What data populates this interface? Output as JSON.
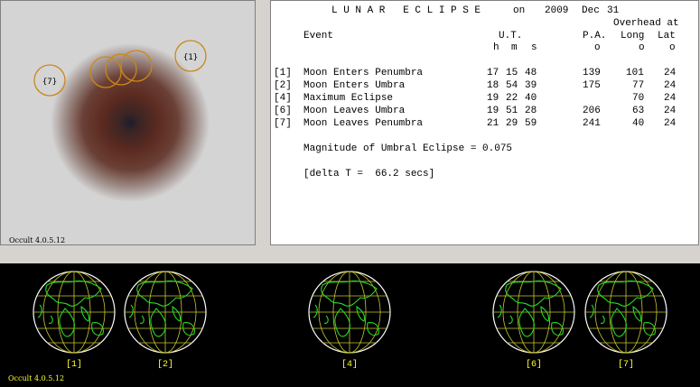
{
  "diagram": {
    "contact_labels": [
      "{1}",
      "{7}"
    ],
    "software": "Occult 4.0.5.12",
    "colors": {
      "penumbra_edge": "#d4d4d4",
      "umbra": "#5b2a20",
      "center": "#1c1e2a",
      "moon_outline": "#c9871a"
    }
  },
  "report": {
    "title": "L U N A R   E C L I P S E",
    "on_label": "on",
    "year": "2009",
    "month": "Dec",
    "day": "31",
    "overhead_header": "Overhead at",
    "event_header": "Event",
    "ut_header": "U.T.",
    "pa_header": "P.A.",
    "long_header": "Long",
    "lat_header": "Lat",
    "h_unit": "h",
    "m_unit": "m",
    "s_unit": "s",
    "degree_mark": "o",
    "events": [
      {
        "num": "[1]",
        "name": "Moon Enters Penumbra",
        "h": "17",
        "m": "15",
        "s": "48",
        "pa": "139",
        "long": "101",
        "lat": "24"
      },
      {
        "num": "[2]",
        "name": "Moon Enters Umbra",
        "h": "18",
        "m": "54",
        "s": "39",
        "pa": "175",
        "long": "77",
        "lat": "24"
      },
      {
        "num": "[4]",
        "name": "Maximum Eclipse",
        "h": "19",
        "m": "22",
        "s": "40",
        "pa": "",
        "long": "70",
        "lat": "24"
      },
      {
        "num": "[6]",
        "name": "Moon Leaves Umbra",
        "h": "19",
        "m": "51",
        "s": "28",
        "pa": "206",
        "long": "63",
        "lat": "24"
      },
      {
        "num": "[7]",
        "name": "Moon Leaves Penumbra",
        "h": "21",
        "m": "29",
        "s": "59",
        "pa": "241",
        "long": "40",
        "lat": "24"
      }
    ],
    "magnitude": "Magnitude of Umbral Eclipse = 0.075",
    "delta_t": "[delta T =  66.2 secs]"
  },
  "globes": {
    "labels": [
      "[1]",
      "[2]",
      "[4]",
      "[6]",
      "[7]"
    ],
    "colors": {
      "grid": "#c8c832",
      "coast": "#22dd22",
      "rim": "#ffffff",
      "label": "#ffff33"
    },
    "software": "Occult 4.0.5.12"
  }
}
